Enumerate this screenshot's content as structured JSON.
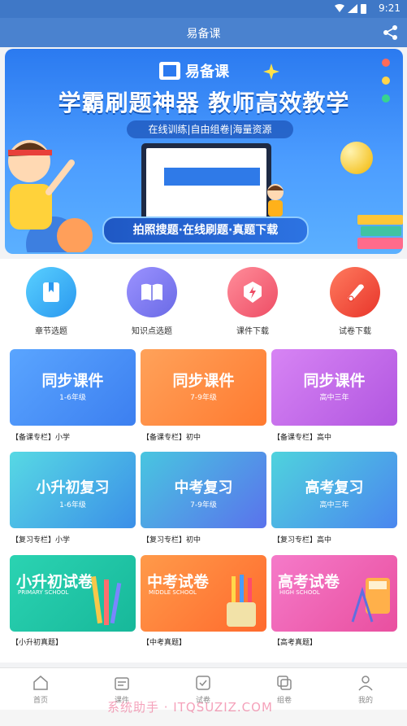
{
  "status": {
    "time": "9:21"
  },
  "header": {
    "title": "易备课"
  },
  "banner": {
    "logo": "易备课",
    "headline": "学霸刷题神器  教师高效教学",
    "subtitle": "在线训练|自由组卷|海量资源",
    "ribbon": "拍照搜题·在线刷题·真题下载"
  },
  "quick": [
    {
      "label": "章节选题",
      "color": "#3bb4f5",
      "icon": "bookmark-book-icon"
    },
    {
      "label": "知识点选题",
      "color": "#7f7ff2",
      "icon": "open-book-icon"
    },
    {
      "label": "课件下载",
      "color": "#f2677a",
      "icon": "download-bolt-icon"
    },
    {
      "label": "试卷下载",
      "color": "#f2513f",
      "icon": "scroll-icon"
    }
  ],
  "cards": [
    {
      "title": "同步课件",
      "sub": "1-6年级",
      "caption": "【备课专栏】小学",
      "color": "#3f8cf0"
    },
    {
      "title": "同步课件",
      "sub": "7-9年级",
      "caption": "【备课专栏】初中",
      "color": "#ff8a3c"
    },
    {
      "title": "同步课件",
      "sub": "高中三年",
      "caption": "【备课专栏】高中",
      "color": "#c067e8"
    },
    {
      "title": "小升初复习",
      "sub": "1-6年级",
      "caption": "【复习专栏】小学",
      "color": "#35c0d8"
    },
    {
      "title": "中考复习",
      "sub": "7-9年级",
      "caption": "【复习专栏】初中",
      "color": "#4f86f0"
    },
    {
      "title": "高考复习",
      "sub": "高中三年",
      "caption": "【复习专栏】高中",
      "color": "#3aa9f0"
    },
    {
      "title": "小升初试卷",
      "sub": "PRIMARY SCHOOL",
      "caption": "【小升初真题】",
      "color": "#21c9a8"
    },
    {
      "title": "中考试卷",
      "sub": "MIDDLE SCHOOL",
      "caption": "【中考真题】",
      "color": "#ff7a3a"
    },
    {
      "title": "高考试卷",
      "sub": "HIGH SCHOOL",
      "caption": "【高考真题】",
      "color": "#ee5fb4"
    }
  ],
  "tabs": [
    {
      "label": "首页",
      "icon": "home-icon"
    },
    {
      "label": "课件",
      "icon": "courseware-icon"
    },
    {
      "label": "试卷",
      "icon": "exam-check-icon"
    },
    {
      "label": "组卷",
      "icon": "stack-icon"
    },
    {
      "label": "我的",
      "icon": "profile-icon"
    }
  ],
  "watermark": "系统助手 · ITQSUZIZ.COM"
}
